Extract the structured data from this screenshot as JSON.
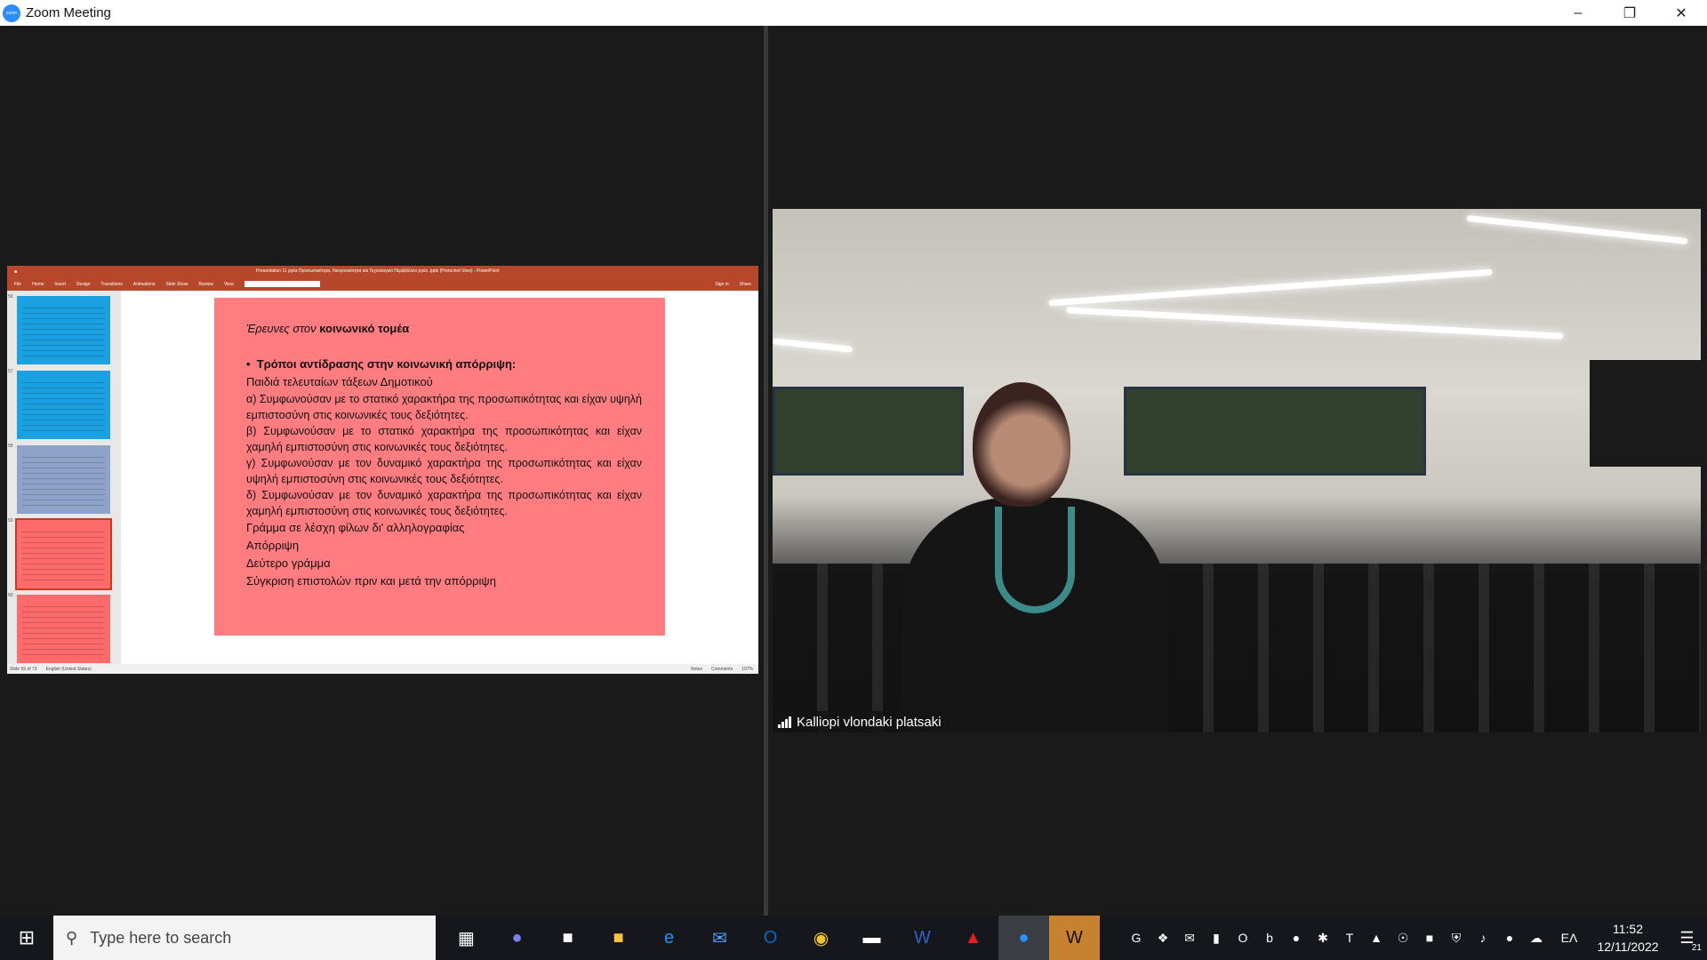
{
  "window": {
    "title": "Zoom Meeting"
  },
  "ppt": {
    "doc_title": "Presentation 11 ργέα Προσωπικότητα, Νεογονικότητα και Τεχνολογικό Περιβάλλον ργέα .pptx (Protected View) - PowerPoint",
    "ribbon_tabs": [
      "File",
      "Home",
      "Insert",
      "Design",
      "Transitions",
      "Animations",
      "Slide Show",
      "Review",
      "View"
    ],
    "sign_in": "Sign in",
    "share": "Share",
    "thumb_numbers": [
      "56",
      "57",
      "58",
      "59",
      "60"
    ],
    "status_slide": "Slide 59 of 73",
    "status_lang": "English (United States)",
    "status_notes": "Notes",
    "status_comments": "Comments",
    "status_zoom": "107%",
    "slide": {
      "heading_prefix": "Έρευνες στον ",
      "heading_strong": "κοινωνικό τομέα",
      "bullet": "Τρόποι αντίδρασης στην κοινωνική απόρριψη:",
      "line1": "Παιδιά τελευταίων τάξεων Δημοτικού",
      "a": "α) Συμφωνούσαν με το στατικό χαρακτήρα της προσωπικότητας και είχαν υψηλή εμπιστοσύνη στις κοινωνικές τους δεξιότητες.",
      "b": "β) Συμφωνούσαν με το στατικό χαρακτήρα της προσωπικότητας και είχαν χαμηλή εμπιστοσύνη στις κοινωνικές τους δεξιότητες.",
      "c": "γ) Συμφωνούσαν με τον δυναμικό χαρακτήρα της προσωπικότητας και είχαν υψηλή εμπιστοσύνη στις κοινωνικές τους δεξιότητες.",
      "d": "δ) Συμφωνούσαν με τον δυναμικό χαρακτήρα της προσωπικότητας και είχαν χαμηλή εμπιστοσύνη στις κοινωνικές τους δεξιότητες.",
      "line2": "Γράμμα σε λέσχη φίλων δι' αλληλογραφίας",
      "line3": "Απόρριψη",
      "line4": "Δεύτερο γράμμα",
      "line5": "Σύγκριση επιστολών πριν και μετά την απόρριψη"
    }
  },
  "video": {
    "participant_name": "Kalliopi vlondaki platsaki"
  },
  "taskbar": {
    "search_placeholder": "Type here to search",
    "time": "11:52",
    "date": "12/11/2022",
    "lang": "ΕΛ",
    "notification_count": "21"
  },
  "colors": {
    "ppt_accent": "#b7472a",
    "slide_bg": "#ff7c80",
    "thumb_blue": "#1ba1e2",
    "thumb_gray": "#8fa3c8",
    "thumb_red": "#ff6b6b"
  }
}
